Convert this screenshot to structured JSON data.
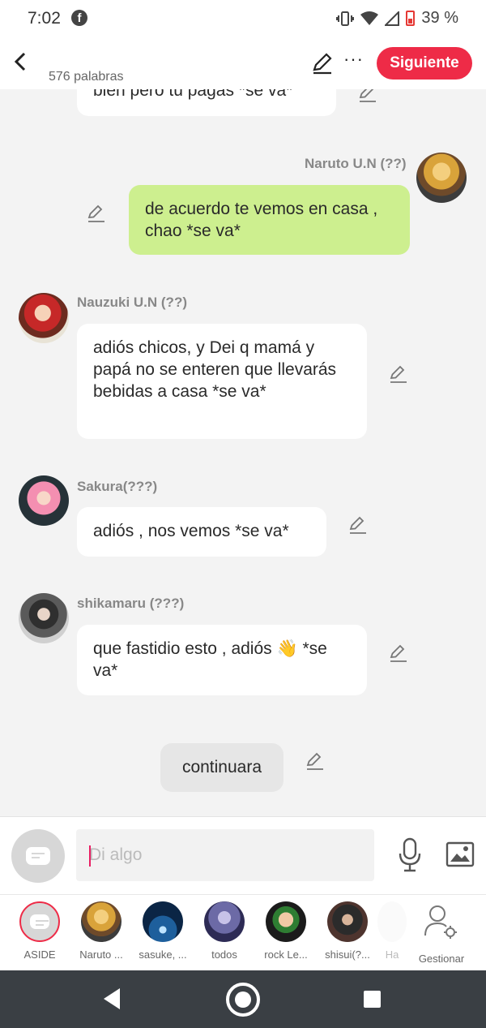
{
  "status_bar": {
    "time": "7:02",
    "facebook_glyph": "f",
    "battery": "39 %"
  },
  "header": {
    "word_count": "576 palabras",
    "more_glyph": "···",
    "next_label": "Siguiente"
  },
  "chat": {
    "partial_message": "bien pero tu pagas *se va*",
    "messages": [
      {
        "sender": "Naruto U.N (??)",
        "text": "de acuerdo te vemos en casa , chao *se va*"
      },
      {
        "sender": "Nauzuki U.N (??)",
        "text": "adiós chicos, y Dei q mamá y papá no se enteren que llevarás bebidas a casa *se va*"
      },
      {
        "sender": "Sakura(???)",
        "text": "adiós , nos vemos *se va*"
      },
      {
        "sender": "shikamaru (???)",
        "text": "que fastidio esto , adiós 👋 *se va*"
      }
    ],
    "narration": "continuara"
  },
  "input": {
    "placeholder": "Di algo"
  },
  "characters": [
    {
      "label": "ASIDE"
    },
    {
      "label": "Naruto ..."
    },
    {
      "label": "sasuke, ..."
    },
    {
      "label": "todos"
    },
    {
      "label": "rock Le..."
    },
    {
      "label": "shisui(?..."
    },
    {
      "label": "Ha"
    },
    {
      "label": "Gestionar"
    }
  ],
  "colors": {
    "accent": "#ee2b47",
    "own_bubble": "#cdef8f",
    "other_bubble": "#ffffff"
  }
}
